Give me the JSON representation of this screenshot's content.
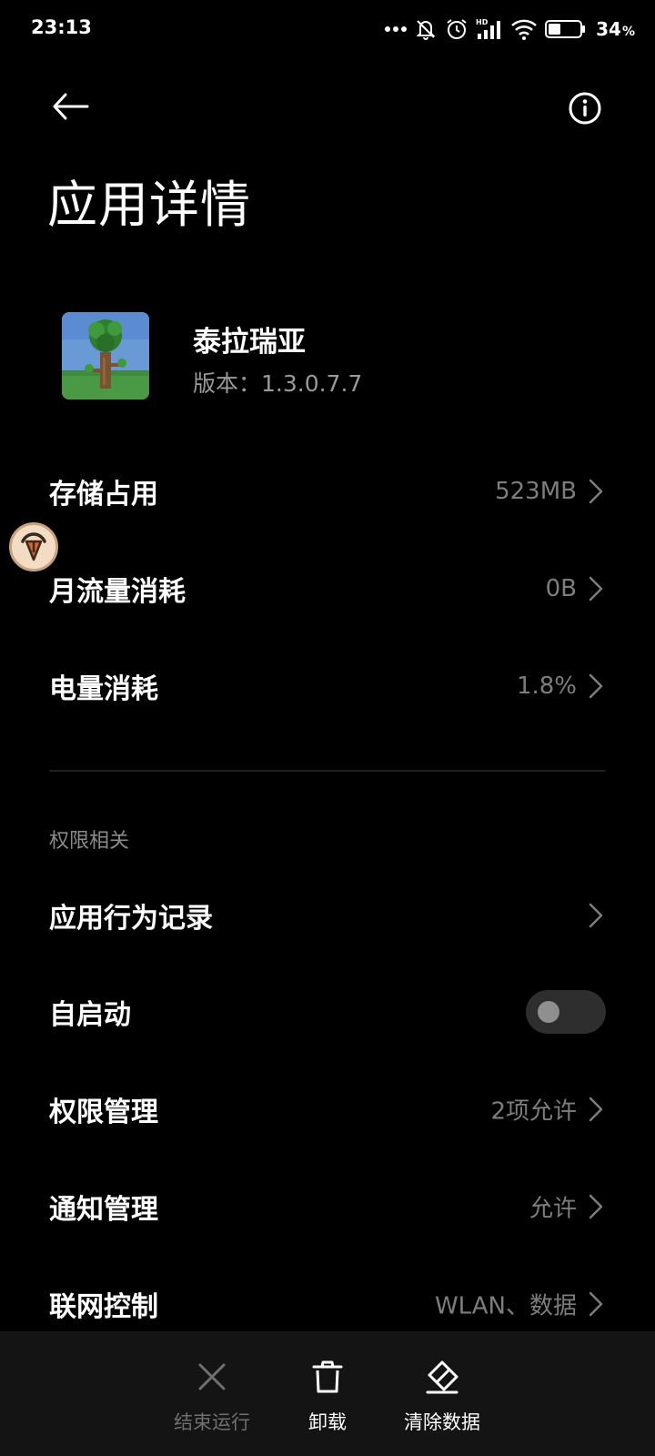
{
  "status_bar": {
    "time": "23:13",
    "network_label": "HD",
    "battery_percent": "34",
    "percent_sign": "%"
  },
  "header": {
    "title": "应用详情"
  },
  "app": {
    "name": "泰拉瑞亚",
    "version": "版本：1.3.0.7.7"
  },
  "rows": {
    "storage": {
      "label": "存储占用",
      "value": "523MB"
    },
    "data_usage": {
      "label": "月流量消耗",
      "value": "0B"
    },
    "battery": {
      "label": "电量消耗",
      "value": "1.8%"
    },
    "permissions_section": "权限相关",
    "behavior_log": {
      "label": "应用行为记录"
    },
    "autostart": {
      "label": "自启动",
      "enabled": false
    },
    "permission_mgmt": {
      "label": "权限管理",
      "value": "2项允许"
    },
    "notification_mgmt": {
      "label": "通知管理",
      "value": "允许"
    },
    "network_control": {
      "label": "联网控制",
      "value": "WLAN、数据"
    }
  },
  "bottom_bar": {
    "force_stop": {
      "label": "结束运行",
      "enabled": false
    },
    "uninstall": {
      "label": "卸载"
    },
    "clear_data": {
      "label": "清除数据"
    }
  },
  "icons": {
    "back": "arrow-left-icon",
    "info": "info-circle-icon",
    "chevron": "chevron-right-icon",
    "force_stop": "close-icon",
    "uninstall": "trash-icon",
    "clear_data": "eraser-icon"
  },
  "colors": {
    "background": "#000000",
    "secondary_text": "#7d7d7d",
    "bottom_bar": "#141414",
    "toggle_off": "#2e2e2e"
  }
}
